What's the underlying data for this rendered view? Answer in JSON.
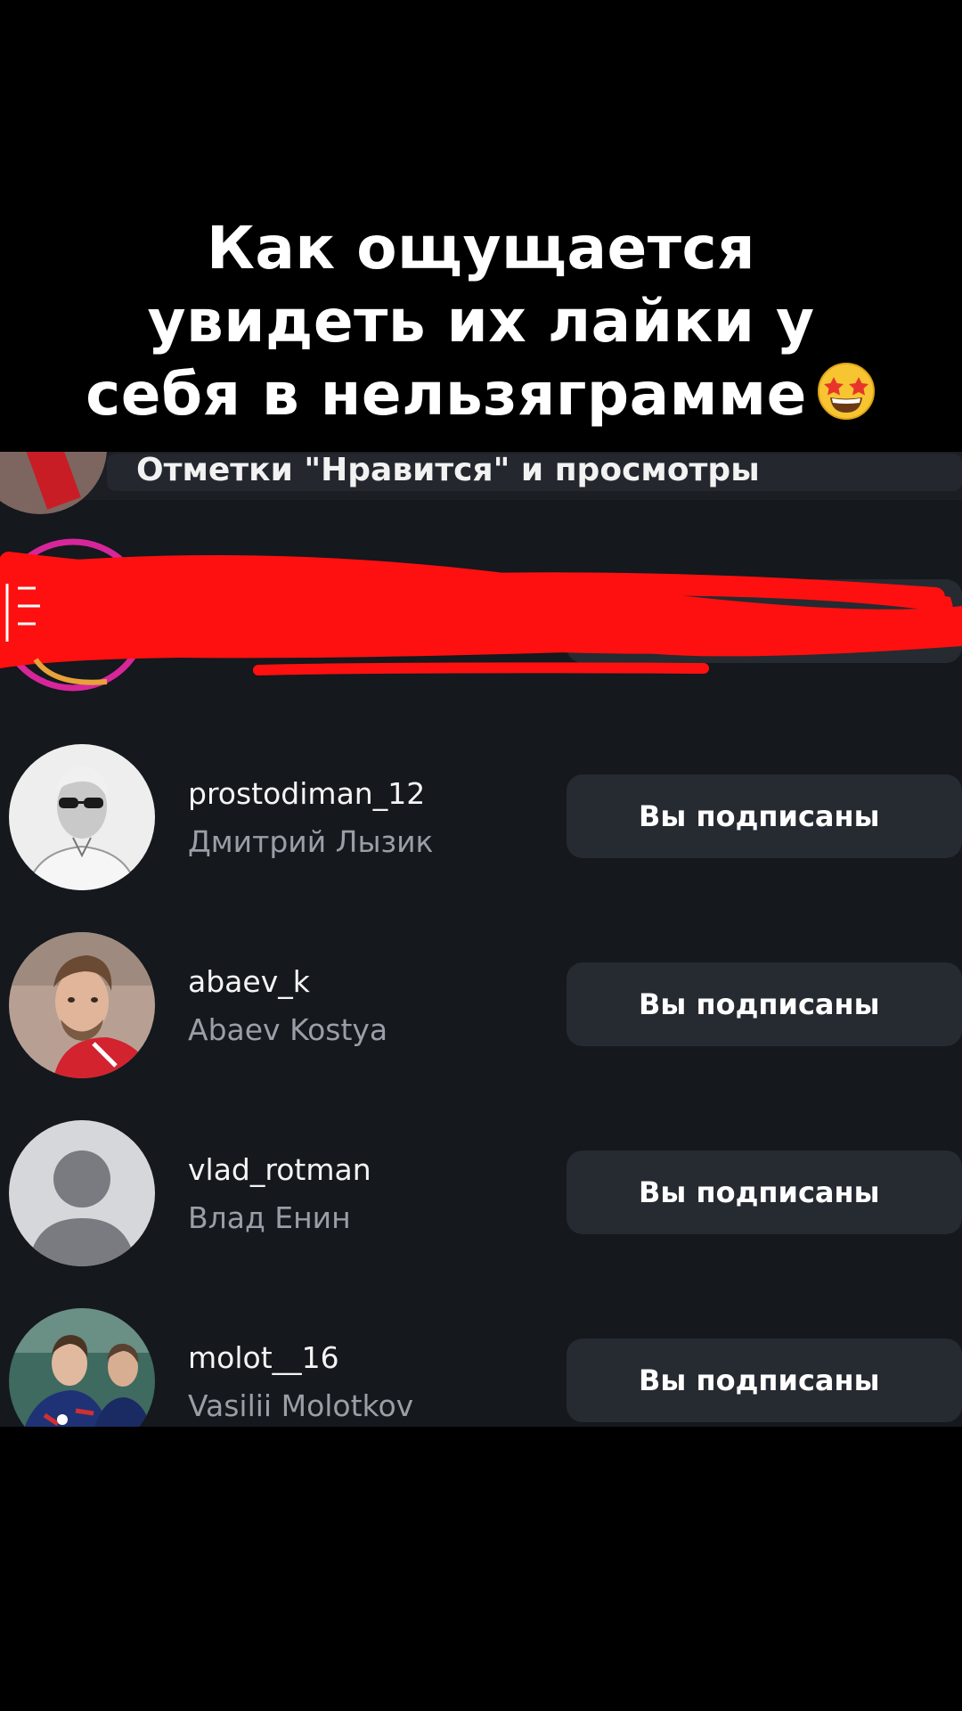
{
  "caption": {
    "lines": [
      "Как ощущается",
      "увидеть их лайки у",
      "себя в нельзяграмме"
    ],
    "emoji": "star-struck-emoji"
  },
  "header": {
    "title": "Отметки \"Нравится\" и просмотры"
  },
  "redaction": {
    "color": "#ff0000"
  },
  "users": [
    {
      "username": "prostodiman_12",
      "full_name": "Дмитрий Лызик",
      "button_label": "Вы подписаны",
      "avatar": "user-photo-avatar"
    },
    {
      "username": "abaev_k",
      "full_name": "Abaev Kostya",
      "button_label": "Вы подписаны",
      "avatar": "user-photo-avatar"
    },
    {
      "username": "vlad_rotman",
      "full_name": "Влад Енин",
      "button_label": "Вы подписаны",
      "avatar": "default-user-avatar"
    },
    {
      "username": "molot__16",
      "full_name": "Vasilii Molotkov",
      "button_label": "Вы подписаны",
      "avatar": "user-photo-avatar"
    }
  ],
  "colors": {
    "background": "#000000",
    "screen_background": "#15181d",
    "button_background": "#262a31",
    "secondary_text": "#9a9ea6"
  }
}
